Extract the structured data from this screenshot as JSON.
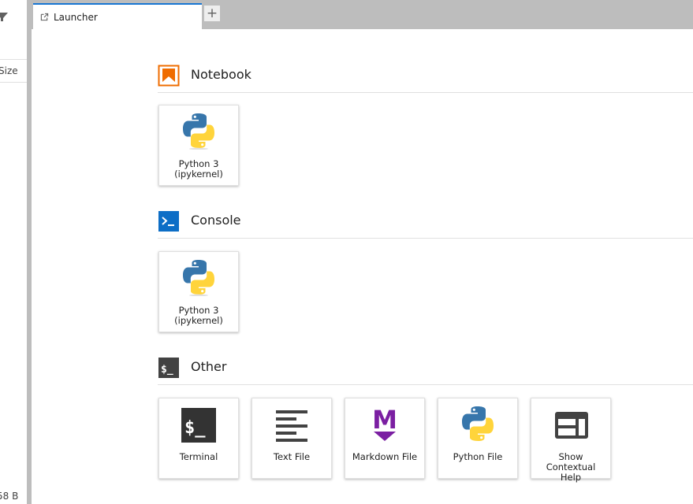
{
  "file_browser": {
    "column_header": "Size",
    "last_item_size": "58 B"
  },
  "tabs": [
    {
      "label": "Launcher"
    }
  ],
  "add_tab_label": "+",
  "sections": {
    "notebook": {
      "title": "Notebook",
      "cards": [
        {
          "line1": "Python 3",
          "line2": "(ipykernel)"
        }
      ]
    },
    "console": {
      "title": "Console",
      "cards": [
        {
          "line1": "Python 3",
          "line2": "(ipykernel)"
        }
      ]
    },
    "other": {
      "title": "Other",
      "cards": [
        {
          "line1": "Terminal",
          "line2": ""
        },
        {
          "line1": "Text File",
          "line2": ""
        },
        {
          "line1": "Markdown File",
          "line2": ""
        },
        {
          "line1": "Python File",
          "line2": ""
        },
        {
          "line1": "Show Contextual",
          "line2": "Help"
        }
      ]
    }
  },
  "colors": {
    "notebook_accent": "#ef6c00",
    "console_accent": "#0d6ec6",
    "markdown_purple": "#7b1fa2",
    "python_blue": "#3776ab",
    "python_yellow": "#ffd43b",
    "tab_accent": "#1976d2"
  }
}
